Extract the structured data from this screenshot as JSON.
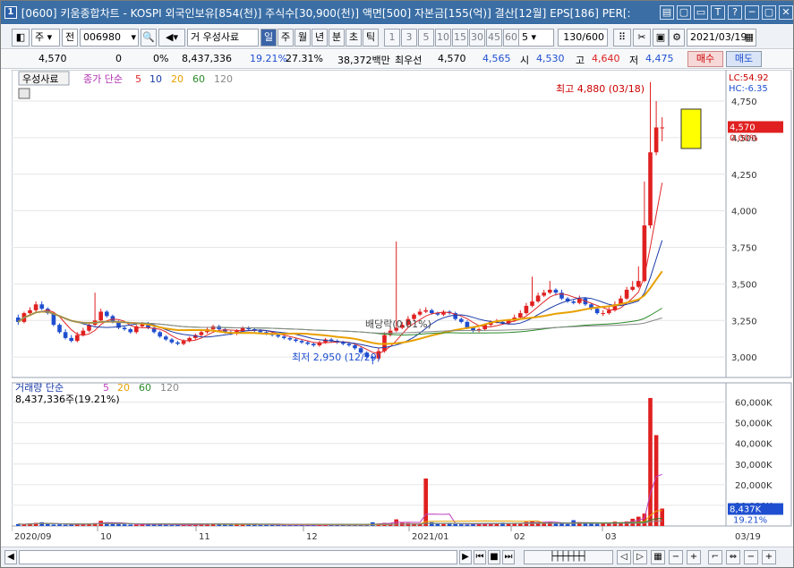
{
  "window": {
    "app_icon": "1",
    "title": "[0600] 키움종합차트 - KOSPI 외국인보유[854(천)] 주식수[30,900(천)] 액면[500] 자본금[155(억)] 결산[12월] EPS[186] PER[:",
    "buttons": [
      "▤",
      "▢",
      "▭",
      "T",
      "?",
      "─",
      "▢",
      "✕"
    ]
  },
  "toolbar": {
    "type_label": "주",
    "market_label": "전",
    "code": "006980",
    "name_prefix": "거",
    "name": "우성사료",
    "periods": [
      "일",
      "주",
      "월",
      "년",
      "분",
      "초",
      "틱"
    ],
    "period_selected": "일",
    "numbers": [
      "1",
      "3",
      "5",
      "10",
      "15",
      "30",
      "45",
      "60"
    ],
    "interval": "5",
    "count": "130/600",
    "date": "2021/03/19"
  },
  "quote": {
    "price": "4,570",
    "change": "0",
    "change_pct": "0%",
    "volume": "8,437,336",
    "vol_ratio": "19.21%",
    "turnover": "27.31%",
    "amount": "38,372백만",
    "best_label": "최우선",
    "best_value": "4,570",
    "bid": "4,565",
    "open_label": "시",
    "open": "4,530",
    "high_label": "고",
    "high": "4,640",
    "low_label": "저",
    "low": "4,475",
    "buy": "매수",
    "sell": "매도"
  },
  "chart_data": {
    "type": "candlestick",
    "stock_name": "우성사료",
    "ma_label": "종가 단순",
    "ma_periods": [
      "5",
      "10",
      "20",
      "60",
      "120"
    ],
    "ma_colors": [
      "#e0282a",
      "#1a3aa8",
      "#e8a000",
      "#2a8a2a",
      "#888888"
    ],
    "price_axis": [
      "4,750",
      "4,500",
      "4,250",
      "4,000",
      "3,750",
      "3,500",
      "3,250",
      "3,000"
    ],
    "price_range": [
      2860,
      4940
    ],
    "lc_label": "LC:54.92",
    "hc_label": "HC:-6.35",
    "current_price": "4,570",
    "current_pct": "0.00%",
    "high_annotation": "최고 4,880 (03/18)",
    "low_annotation": "최저 2,950 (12/29)",
    "dividend_annotation": "배당락(0.01%)",
    "volume_label": "거래량 단순",
    "volume_ma_periods": [
      "5",
      "20",
      "60",
      "120"
    ],
    "volume_summary": "8,437,336주(19.21%)",
    "volume_axis": [
      "60,000K",
      "50,000K",
      "40,000K",
      "30,000K",
      "20,000K",
      "10,000K"
    ],
    "volume_range": [
      0,
      65000
    ],
    "volume_current": "8,437K",
    "volume_current_pct": "19.21%",
    "x_labels": [
      "2020/09",
      "10",
      "11",
      "12",
      "2021/01",
      "02",
      "03"
    ],
    "last_date": "03/19",
    "candles_open": [
      3270,
      3240,
      3300,
      3320,
      3360,
      3330,
      3300,
      3220,
      3170,
      3130,
      3110,
      3150,
      3180,
      3220,
      3250,
      3310,
      3280,
      3240,
      3200,
      3190,
      3170,
      3210,
      3230,
      3200,
      3170,
      3140,
      3120,
      3100,
      3090,
      3110,
      3130,
      3150,
      3170,
      3190,
      3210,
      3190,
      3170,
      3160,
      3180,
      3200,
      3190,
      3180,
      3170,
      3160,
      3150,
      3140,
      3130,
      3120,
      3110,
      3100,
      3090,
      3080,
      3100,
      3120,
      3110,
      3100,
      3090,
      3080,
      3060,
      3030,
      3000,
      2990,
      3040,
      3150,
      3180,
      3200,
      3220,
      3260,
      3290,
      3310,
      3320,
      3300,
      3290,
      3310,
      3300,
      3260,
      3240,
      3200,
      3180,
      3190,
      3220,
      3240,
      3240,
      3230,
      3250,
      3270,
      3300,
      3350,
      3380,
      3420,
      3440,
      3460,
      3440,
      3400,
      3380,
      3370,
      3400,
      3360,
      3330,
      3300,
      3300,
      3320,
      3360,
      3400,
      3460,
      3480,
      3520,
      3900,
      4400,
      4570
    ],
    "candles_close": [
      3240,
      3300,
      3320,
      3360,
      3330,
      3300,
      3220,
      3170,
      3130,
      3110,
      3150,
      3180,
      3220,
      3250,
      3310,
      3280,
      3240,
      3200,
      3190,
      3170,
      3210,
      3230,
      3200,
      3170,
      3140,
      3120,
      3100,
      3090,
      3110,
      3130,
      3150,
      3170,
      3190,
      3210,
      3190,
      3170,
      3160,
      3180,
      3200,
      3190,
      3180,
      3170,
      3160,
      3150,
      3140,
      3130,
      3120,
      3110,
      3100,
      3090,
      3080,
      3100,
      3120,
      3110,
      3100,
      3090,
      3080,
      3060,
      3030,
      3000,
      2990,
      3040,
      3150,
      3180,
      3200,
      3220,
      3260,
      3290,
      3310,
      3320,
      3300,
      3290,
      3310,
      3300,
      3260,
      3240,
      3200,
      3180,
      3190,
      3220,
      3240,
      3240,
      3230,
      3250,
      3270,
      3300,
      3350,
      3380,
      3420,
      3440,
      3460,
      3440,
      3400,
      3380,
      3370,
      3400,
      3360,
      3330,
      3300,
      3300,
      3320,
      3360,
      3400,
      3460,
      3480,
      3520,
      3900,
      4400,
      4570,
      4570
    ],
    "candles_high": [
      3290,
      3310,
      3340,
      3380,
      3380,
      3340,
      3310,
      3230,
      3190,
      3150,
      3170,
      3200,
      3240,
      3440,
      3330,
      3320,
      3290,
      3250,
      3210,
      3200,
      3220,
      3240,
      3240,
      3210,
      3180,
      3150,
      3130,
      3110,
      3120,
      3140,
      3160,
      3180,
      3200,
      3220,
      3220,
      3200,
      3180,
      3190,
      3210,
      3210,
      3200,
      3190,
      3180,
      3170,
      3160,
      3150,
      3140,
      3130,
      3120,
      3110,
      3100,
      3110,
      3130,
      3130,
      3120,
      3110,
      3100,
      3090,
      3070,
      3040,
      3010,
      3060,
      3170,
      3200,
      3790,
      3240,
      3280,
      3300,
      3330,
      3340,
      3330,
      3310,
      3320,
      3320,
      3310,
      3270,
      3250,
      3210,
      3200,
      3230,
      3250,
      3260,
      3250,
      3260,
      3290,
      3320,
      3370,
      3550,
      3440,
      3460,
      3520,
      3470,
      3460,
      3410,
      3390,
      3420,
      3410,
      3370,
      3340,
      3320,
      3340,
      3380,
      3420,
      3480,
      3520,
      3620,
      4200,
      4880,
      4750,
      4640
    ],
    "candles_low": [
      3220,
      3230,
      3280,
      3300,
      3320,
      3290,
      3210,
      3160,
      3120,
      3100,
      3100,
      3140,
      3170,
      3210,
      3240,
      3270,
      3230,
      3190,
      3180,
      3160,
      3160,
      3200,
      3190,
      3160,
      3130,
      3110,
      3090,
      3080,
      3080,
      3100,
      3120,
      3140,
      3160,
      3180,
      3180,
      3160,
      3150,
      3150,
      3170,
      3180,
      3170,
      3160,
      3150,
      3140,
      3130,
      3120,
      3110,
      3100,
      3090,
      3080,
      3070,
      3070,
      3090,
      3100,
      3090,
      3080,
      3070,
      3050,
      3020,
      2990,
      2950,
      2980,
      3030,
      3140,
      3170,
      3190,
      3210,
      3250,
      3280,
      3300,
      3290,
      3280,
      3280,
      3290,
      3250,
      3230,
      3190,
      3170,
      3170,
      3180,
      3210,
      3230,
      3220,
      3220,
      3240,
      3260,
      3290,
      3340,
      3370,
      3410,
      3430,
      3420,
      3390,
      3370,
      3360,
      3360,
      3350,
      3320,
      3290,
      3280,
      3290,
      3310,
      3350,
      3390,
      3450,
      3470,
      3510,
      3880,
      4380,
      4475
    ],
    "volumes": [
      900,
      800,
      1200,
      1500,
      1800,
      900,
      700,
      800,
      600,
      700,
      900,
      1000,
      1100,
      1400,
      2500,
      1800,
      1200,
      900,
      800,
      700,
      600,
      700,
      800,
      900,
      700,
      600,
      500,
      500,
      600,
      700,
      800,
      900,
      1000,
      1100,
      900,
      800,
      700,
      800,
      900,
      800,
      700,
      600,
      600,
      500,
      500,
      400,
      400,
      500,
      500,
      400,
      400,
      500,
      600,
      700,
      600,
      500,
      400,
      400,
      600,
      800,
      1800,
      1200,
      1500,
      1300,
      3200,
      1500,
      1400,
      1200,
      1100,
      23000,
      1800,
      1200,
      1000,
      1500,
      900,
      800,
      700,
      900,
      1200,
      1100,
      1000,
      1400,
      1600,
      1200,
      1100,
      1300,
      2000,
      2500,
      1800,
      1600,
      1800,
      1400,
      1200,
      1000,
      2800,
      1800,
      1200,
      1100,
      1000,
      1500,
      1200,
      2100,
      1800,
      2200,
      3500,
      4500,
      6000,
      62000,
      44000,
      8437
    ]
  }
}
